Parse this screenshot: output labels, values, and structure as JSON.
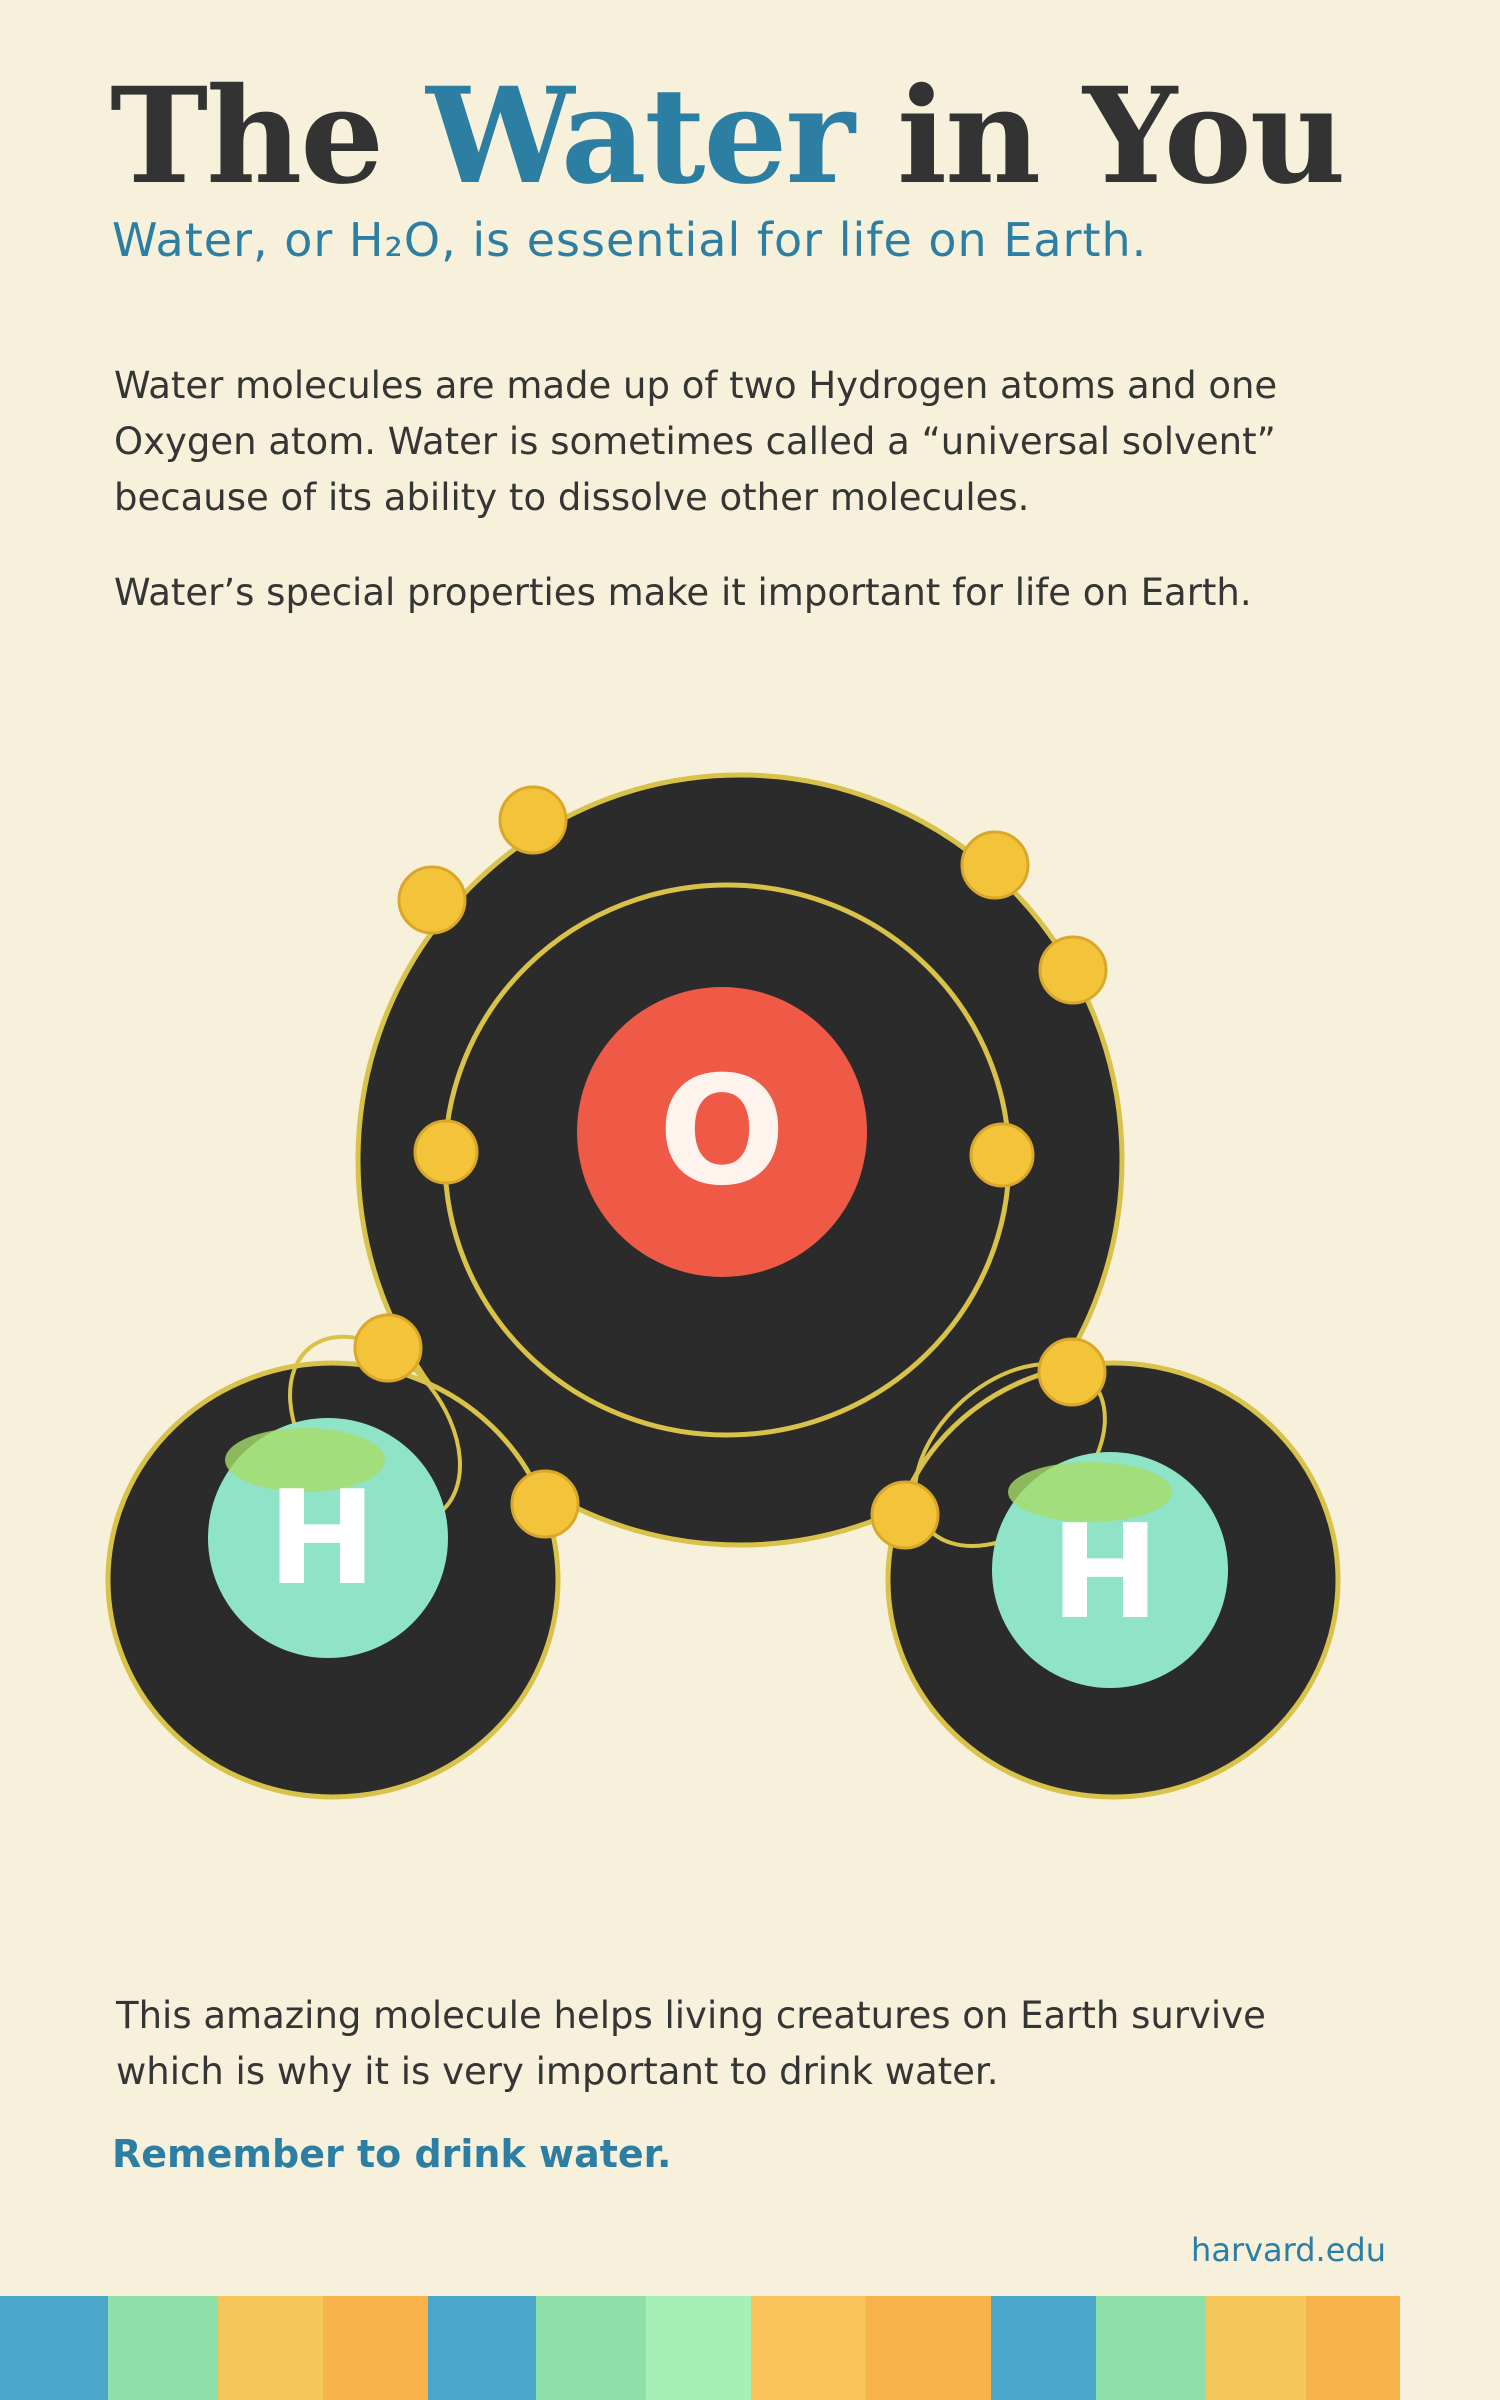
{
  "title": {
    "part1": "The",
    "part2": "Water",
    "part3": "in You"
  },
  "subtitle": "Water, or H₂O, is essential for life on Earth.",
  "paragraphs": {
    "p1": "Water molecules are made up of two Hydrogen atoms and one Oxygen atom. Water is sometimes called a “universal solvent” because of its ability to dissolve other molecules.",
    "p2": "Water’s special properties make it important for life on Earth.",
    "p3": "This amazing molecule helps living creatures on Earth survive which is why it is very important to drink water."
  },
  "call_to_action": "Remember to drink water.",
  "source": "harvard.edu",
  "molecule": {
    "oxygen_label": "O",
    "hydrogen_label_left": "H",
    "hydrogen_label_right": "H"
  },
  "colors": {
    "background": "#f7f0da",
    "accent_blue": "#2d7ea3",
    "text_dark": "#333333",
    "atom_shell": "#2b2b2b",
    "orbit_ring": "#d8c24a",
    "electron": "#f3c43a",
    "oxygen_nucleus": "#ef5a47",
    "hydrogen_nucleus": "#8fe3c6",
    "stripe_colors": [
      "#4aa7c9",
      "#8fe0a8",
      "#f5c75a",
      "#f7b24a",
      "#4aa7c9",
      "#8fe0a8",
      "#a6f0b8",
      "#f7c35a",
      "#f7b24a",
      "#4aa7c9",
      "#8fe0a8",
      "#f5c75a",
      "#f7b24a"
    ]
  },
  "icons": [
    "oxygen-atom",
    "hydrogen-atom",
    "electron"
  ]
}
